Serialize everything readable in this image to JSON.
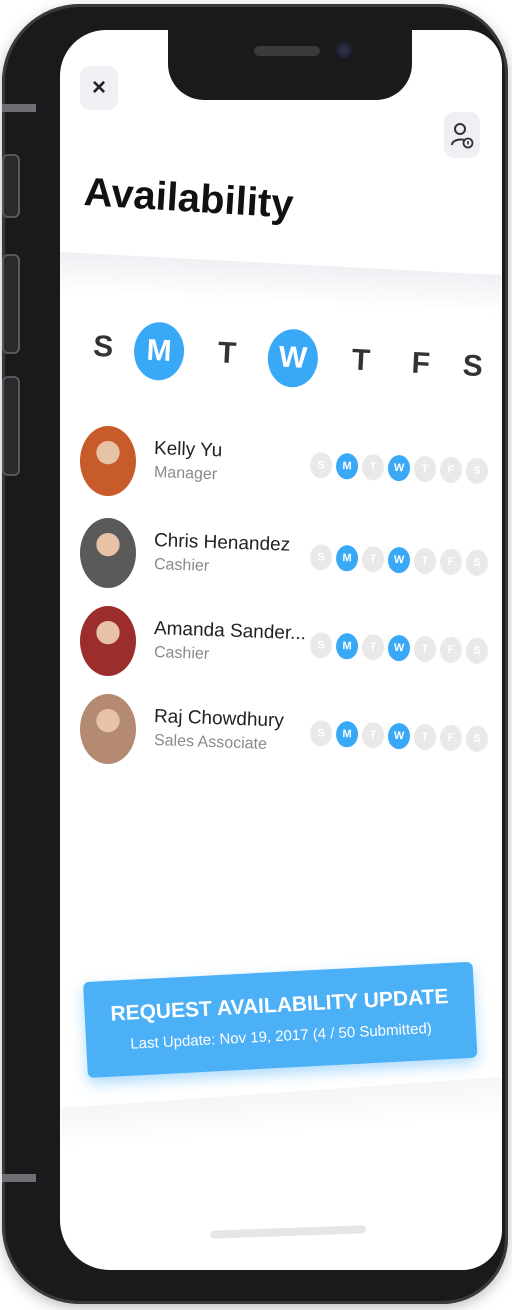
{
  "header": {
    "close_label": "×",
    "title": "Availability"
  },
  "week_days": [
    {
      "label": "S",
      "active": false
    },
    {
      "label": "M",
      "active": true
    },
    {
      "label": "T",
      "active": false
    },
    {
      "label": "W",
      "active": true
    },
    {
      "label": "T",
      "active": false
    },
    {
      "label": "F",
      "active": false
    },
    {
      "label": "S",
      "active": false
    }
  ],
  "employees": [
    {
      "name": "Kelly Yu",
      "role": "Manager",
      "avatar_color": "#c85b2a"
    },
    {
      "name": "Chris Henandez",
      "role": "Cashier",
      "avatar_color": "#5a5a5a"
    },
    {
      "name": "Amanda Sander...",
      "role": "Cashier",
      "avatar_color": "#9b2d2d"
    },
    {
      "name": "Raj Chowdhury",
      "role": "Sales Associate",
      "avatar_color": "#b58a72"
    }
  ],
  "employee_days": [
    "S",
    "M",
    "T",
    "W",
    "T",
    "F",
    "S"
  ],
  "employee_active_days": [
    1,
    3
  ],
  "request": {
    "title": "REQUEST AVAILABILITY UPDATE",
    "subtitle": "Last Update: Nov 19, 2017 (4 / 50 Submitted)"
  },
  "colors": {
    "accent": "#39a8f6",
    "inactive_day": "#e9e9ea"
  }
}
